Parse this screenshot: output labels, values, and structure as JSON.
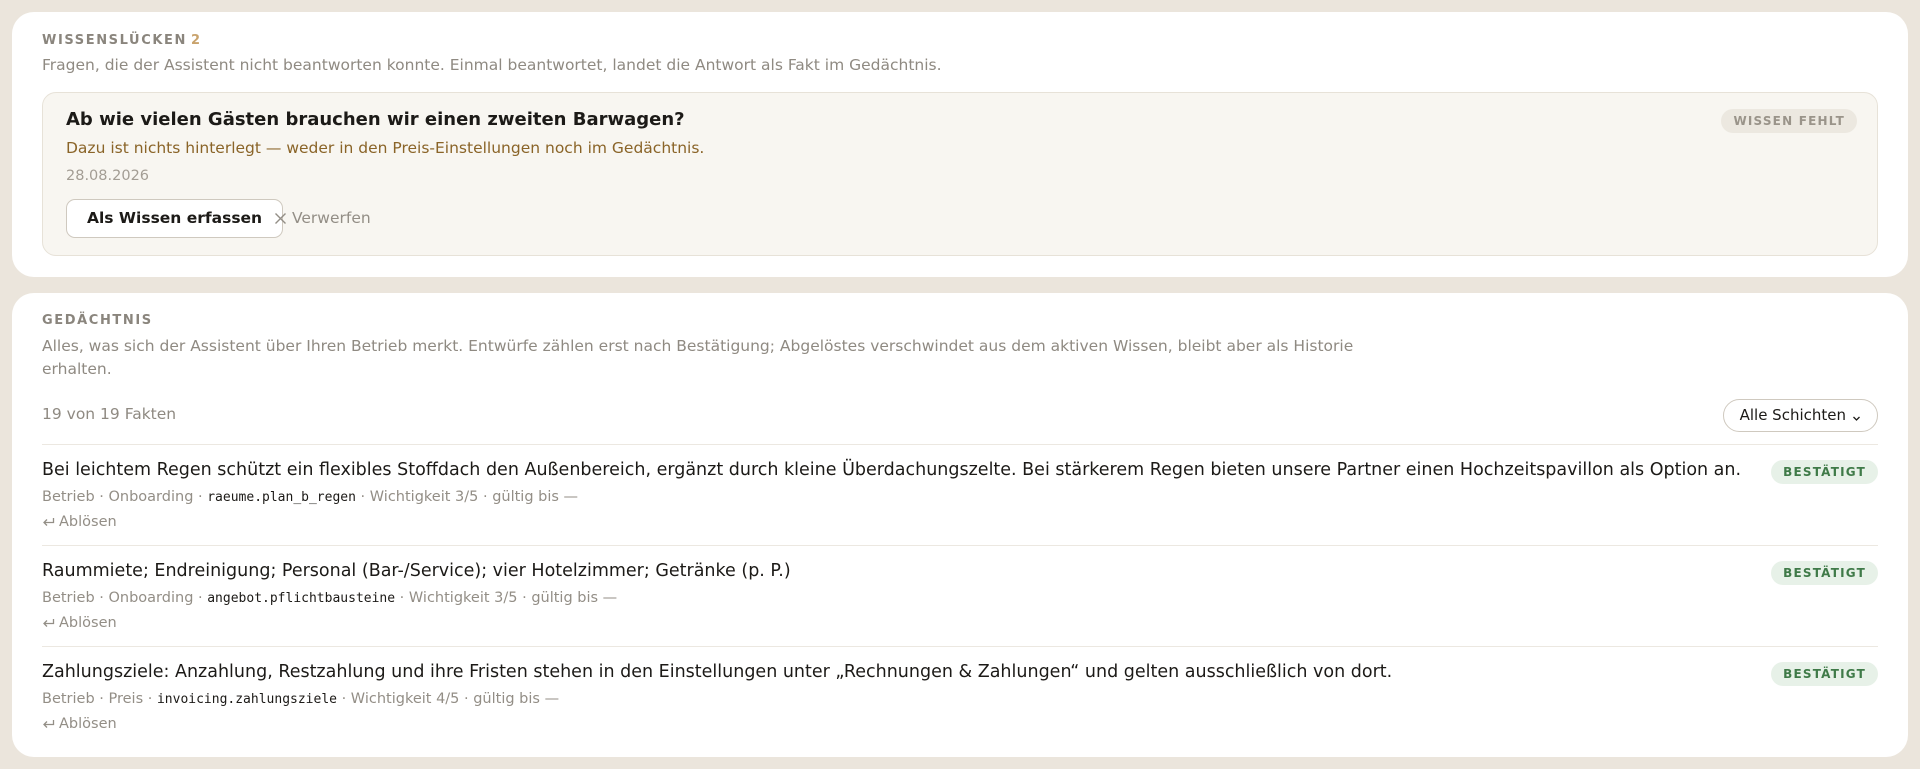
{
  "gaps": {
    "label": "WISSENSLÜCKEN",
    "count": "2",
    "description": "Fragen, die der Assistent nicht beantworten konnte. Einmal beantwortet, landet die Antwort als Fakt im Gedächtnis.",
    "item": {
      "question": "Ab wie vielen Gästen brauchen wir einen zweiten Barwagen?",
      "reason": "Dazu ist nichts hinterlegt — weder in den Preis-Einstellungen noch im Gedächtnis.",
      "date": "28.08.2026",
      "badge": "WISSEN FEHLT",
      "capture_label": "Als Wissen erfassen",
      "discard_label": "Verwerfen"
    }
  },
  "memory": {
    "label": "GEDÄCHTNIS",
    "description_line1": "Alles, was sich der Assistent über Ihren Betrieb merkt. Entwürfe zählen erst nach Bestätigung; Abgelöstes verschwindet aus dem aktiven Wissen, bleibt aber als Historie",
    "description_line2": "erhalten.",
    "fact_count": "19 von 19 Fakten",
    "layer_filter": "Alle Schichten",
    "facts": [
      {
        "text": "Bei leichtem Regen schützt ein flexibles Stoffdach den Außenbereich, ergänzt durch kleine Überdachungszelte. Bei stärkerem Regen bieten unsere Partner einen Hochzeitspavillon als Option an.",
        "meta_prefix": "Betrieb · Onboarding · ",
        "key": "raeume.plan_b_regen",
        "meta_suffix": " · Wichtigkeit 3/5 · gültig bis —",
        "badge": "BESTÄTIGT",
        "action": "Ablösen"
      },
      {
        "text": "Raummiete; Endreinigung; Personal (Bar-/Service); vier Hotelzimmer; Getränke (p. P.)",
        "meta_prefix": "Betrieb · Onboarding · ",
        "key": "angebot.pflichtbausteine",
        "meta_suffix": " · Wichtigkeit 3/5 · gültig bis —",
        "badge": "BESTÄTIGT",
        "action": "Ablösen"
      },
      {
        "text": "Zahlungsziele: Anzahlung, Restzahlung und ihre Fristen stehen in den Einstellungen unter „Rechnungen & Zahlungen“ und gelten ausschließlich von dort.",
        "meta_prefix": "Betrieb · Preis · ",
        "key": "invoicing.zahlungsziele",
        "meta_suffix": " · Wichtigkeit 4/5 · gültig bis —",
        "badge": "BESTÄTIGT",
        "action": "Ablösen"
      }
    ]
  }
}
